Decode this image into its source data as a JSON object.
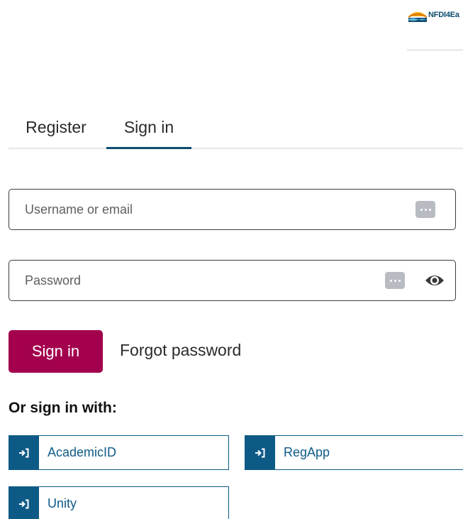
{
  "header": {
    "logo_text": "NFDI4Ea",
    "logo_icon": "nfdi4earth-logo-icon"
  },
  "tabs": [
    {
      "label": "Register",
      "active": false
    },
    {
      "label": "Sign in",
      "active": true
    }
  ],
  "form": {
    "username": {
      "value": "",
      "placeholder": "Username or email"
    },
    "password": {
      "value": "",
      "placeholder": "Password"
    },
    "password_manager_icon": "password-manager-icon",
    "show_password_icon": "eye-icon",
    "submit_label": "Sign in",
    "forgot_label": "Forgot password"
  },
  "alternatives": {
    "heading": "Or sign in with:",
    "icon": "sign-in-arrow-icon",
    "providers": [
      {
        "label": "AcademicID"
      },
      {
        "label": "RegApp"
      },
      {
        "label": "Unity"
      }
    ]
  },
  "colors": {
    "primary_button": "#a3004d",
    "provider_accent": "#0e5a86",
    "tab_indicator": "#0e4c6e"
  }
}
